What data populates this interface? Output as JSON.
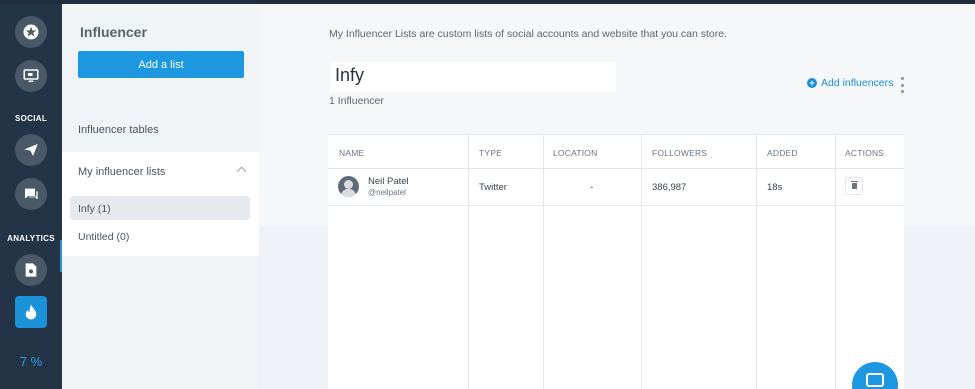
{
  "rail": {
    "social_label": "SOCIAL",
    "analytics_label": "ANALYTICS",
    "progress_text": "7 %",
    "icons": [
      "star-icon",
      "monitor-icon",
      "paper-plane-icon",
      "chat-icon",
      "report-icon",
      "fire-icon"
    ]
  },
  "sidebar": {
    "title": "Influencer",
    "add_button": "Add a list",
    "tables_link": "Influencer tables",
    "lists_header": "My influencer lists",
    "items": [
      {
        "label": "Infy (1)",
        "selected": true
      },
      {
        "label": "Untitled (0)",
        "selected": false
      }
    ]
  },
  "main": {
    "description": "My Influencer Lists are custom lists of social accounts and website that you can store.",
    "list_name": "Infy",
    "count_text": "1 Influencer",
    "add_influencers": "Add influencers",
    "accent": "#1d97e0"
  },
  "table": {
    "headers": [
      "NAME",
      "TYPE",
      "LOCATION",
      "FOLLOWERS",
      "ADDED",
      "ACTIONS"
    ],
    "rows": [
      {
        "name": "Neil Patel",
        "handle": "@neilpatel",
        "type": "Twitter",
        "location": "-",
        "followers": "386,987",
        "added": "18s"
      }
    ]
  }
}
